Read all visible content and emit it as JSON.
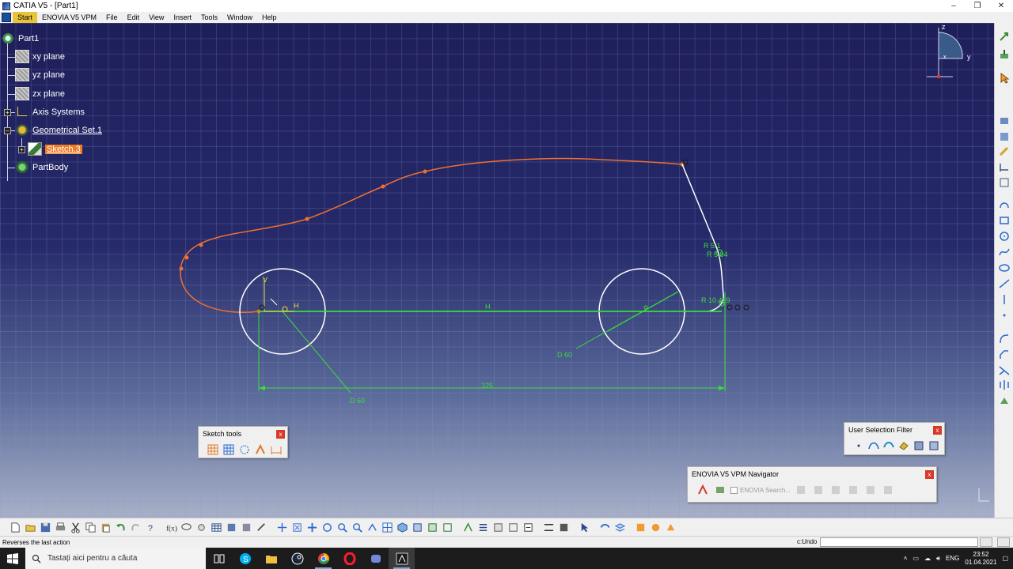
{
  "window": {
    "title": "CATIA V5 - [Part1]",
    "controls": [
      "–",
      "❐",
      "✕"
    ]
  },
  "menu": {
    "items": [
      "Start",
      "ENOVIA V5 VPM",
      "File",
      "Edit",
      "View",
      "Insert",
      "Tools",
      "Window",
      "Help"
    ],
    "active": "Start"
  },
  "tree": {
    "root": "Part1",
    "nodes": [
      {
        "label": "xy plane",
        "icon": "plane-icon"
      },
      {
        "label": "yz plane",
        "icon": "plane-icon"
      },
      {
        "label": "zx plane",
        "icon": "plane-icon"
      },
      {
        "label": "Axis Systems",
        "icon": "axis-system-icon"
      },
      {
        "label": "Geometrical Set.1",
        "icon": "geometrical-set-icon"
      },
      {
        "label": "Sketch.3",
        "icon": "sketch-icon"
      },
      {
        "label": "PartBody",
        "icon": "partbody-icon"
      }
    ]
  },
  "sketch": {
    "constraints": {
      "d60_left": "D 60",
      "d60_right": "D 60",
      "length": "325",
      "h_label_1": "H",
      "h_label_2": "H",
      "r_top_1": "R 5.1",
      "r_top_2": "R 5.84",
      "r_bottom": "R 10.429",
      "v_label": "V"
    },
    "colors": {
      "profile": "#f07030",
      "constraint": "#3adc3a",
      "geometry": "#ffffff"
    }
  },
  "compass": {
    "z": "z",
    "y": "y",
    "x": "x"
  },
  "palettes": {
    "sketch_tools": {
      "title": "Sketch tools"
    },
    "user_selection_filter": {
      "title": "User Selection Filter"
    },
    "enovia_navigator": {
      "title": "ENOVIA V5 VPM Navigator",
      "search_label": "ENOVIA Search..."
    }
  },
  "status": {
    "message": "Reverses the last action",
    "command_label": "c:Undo",
    "command_value": ""
  },
  "taskbar": {
    "search_placeholder": "Tastați aici pentru a căuta",
    "language": "ENG",
    "time": "23:52",
    "date": "01.04.2021"
  }
}
